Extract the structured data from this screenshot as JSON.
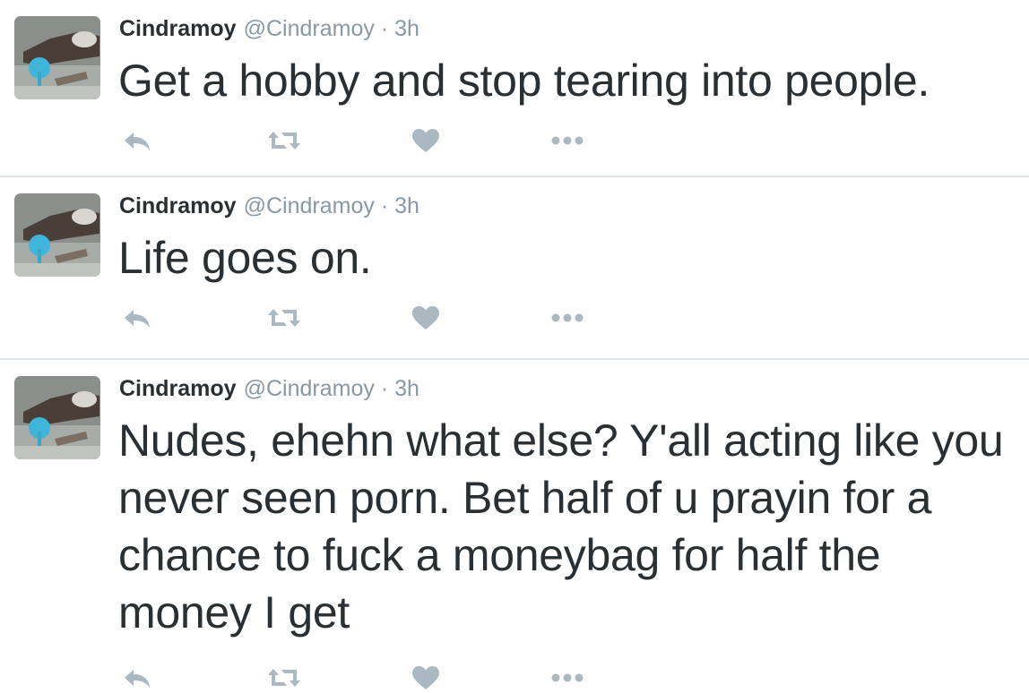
{
  "colors": {
    "text": "#292f33",
    "muted": "#8899a6",
    "icon": "#aab8c2",
    "divider": "#e1e8ed"
  },
  "tweets": [
    {
      "name": "Cindramoy",
      "handle": "@Cindramoy",
      "separator": "·",
      "time": "3h",
      "text": "Get a hobby and stop tearing into people.",
      "icons": [
        "reply-icon",
        "retweet-icon",
        "like-icon",
        "more-icon"
      ]
    },
    {
      "name": "Cindramoy",
      "handle": "@Cindramoy",
      "separator": "·",
      "time": "3h",
      "text": "Life goes on.",
      "icons": [
        "reply-icon",
        "retweet-icon",
        "like-icon",
        "more-icon"
      ]
    },
    {
      "name": "Cindramoy",
      "handle": "@Cindramoy",
      "separator": "·",
      "time": "3h",
      "text": "Nudes, ehehn what else? Y'all acting like you never seen porn. Bet half of u prayin for a chance to fuck a moneybag for half the money I get",
      "icons": [
        "reply-icon",
        "retweet-icon",
        "like-icon",
        "more-icon"
      ]
    }
  ]
}
